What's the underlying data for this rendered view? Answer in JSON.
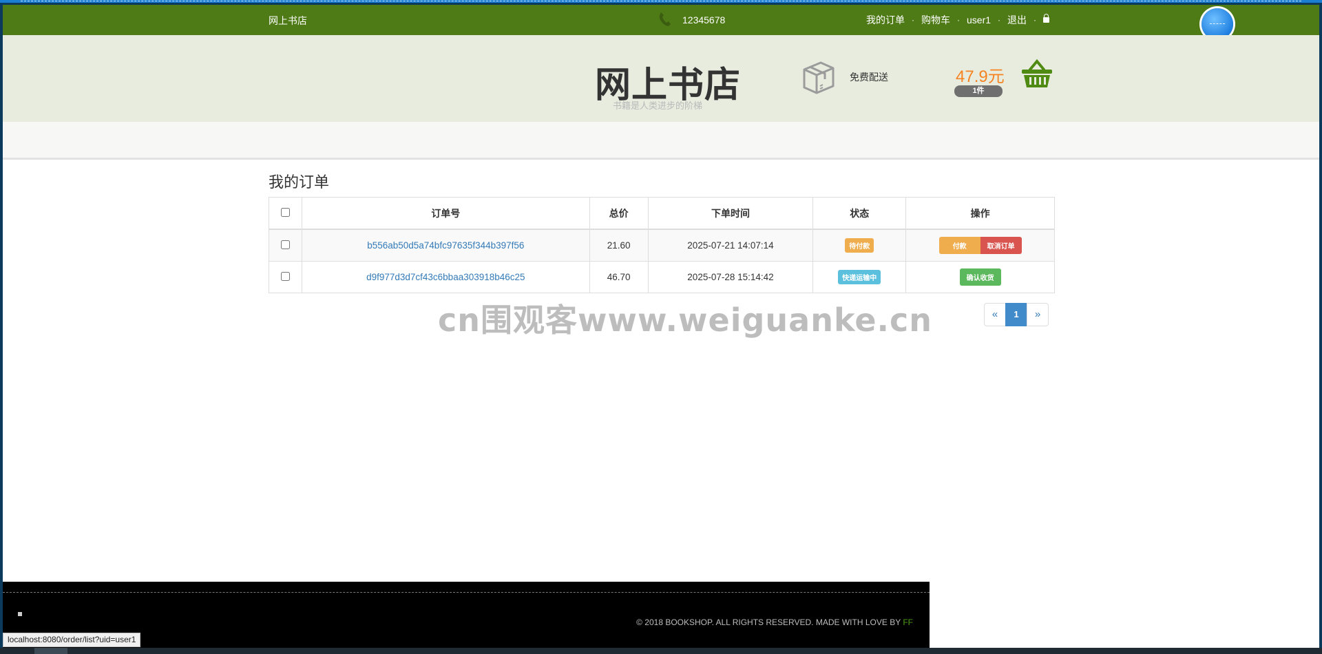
{
  "topbar": {
    "shop_name": "网上书店",
    "phone": "12345678",
    "links": [
      "我的订单",
      "购物车",
      "user1",
      "退出"
    ],
    "separator": "·"
  },
  "header": {
    "title": "网上书店",
    "subtitle": "书籍是人类进步的阶梯",
    "free_shipping": "免费配送",
    "cart_total": "47.9元",
    "cart_count": "1件"
  },
  "orders": {
    "title": "我的订单",
    "columns": [
      "订单号",
      "总价",
      "下单时间",
      "状态",
      "操作"
    ],
    "rows": [
      {
        "id": "b556ab50d5a74bfc97635f344b397f56",
        "total": "21.60",
        "time": "2025-07-21 14:07:14",
        "status": "待付款",
        "actions": [
          "付款",
          "取消订单"
        ]
      },
      {
        "id": "d9f977d3d7cf43c6bbaa303918b46c25",
        "total": "46.70",
        "time": "2025-07-28 15:14:42",
        "status": "快递运输中",
        "actions": [
          "确认收货"
        ]
      }
    ]
  },
  "pagination": {
    "prev": "«",
    "current": "1",
    "next": "»"
  },
  "watermark": "cn围观客www.weiguanke.cn",
  "footer": {
    "copyright": "© 2018 BOOKSHOP. ALL RIGHTS RESERVED. MADE WITH LOVE BY ",
    "author": "FF"
  },
  "status_url": "localhost:8080/order/list?uid=user1",
  "colors": {
    "topbar": "#4f7b17",
    "header_bg": "#e8ecdf",
    "price": "#f58321",
    "link": "#337ab7"
  }
}
